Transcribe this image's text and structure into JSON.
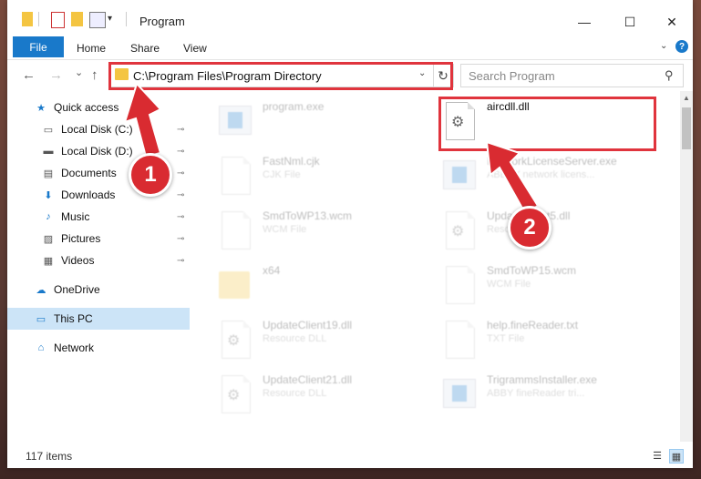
{
  "window": {
    "title": "Program",
    "minimize": "—",
    "maximize": "☐",
    "close": "✕"
  },
  "ribbon": {
    "file": "File",
    "home": "Home",
    "share": "Share",
    "view": "View",
    "help": "?",
    "collapse": "⌄"
  },
  "nav": {
    "back": "←",
    "forward": "→",
    "recent": "⌄",
    "up": "↑",
    "address": "C:\\Program Files\\Program Directory",
    "address_dropdown": "⌄",
    "refresh": "↻",
    "search_placeholder": "Search Program",
    "search_icon": "⚲"
  },
  "sidebar": {
    "items": [
      {
        "label": "Quick access",
        "icon": "star-icon",
        "glyph": "★",
        "pinned": false,
        "selected": false
      },
      {
        "label": "Local Disk (C:)",
        "icon": "drive-icon",
        "glyph": "▭",
        "pinned": true,
        "selected": false
      },
      {
        "label": "Local Disk (D:)",
        "icon": "drive-icon",
        "glyph": "▬",
        "pinned": true,
        "selected": false
      },
      {
        "label": "Documents",
        "icon": "documents-icon",
        "glyph": "▤",
        "pinned": true,
        "selected": false
      },
      {
        "label": "Downloads",
        "icon": "downloads-icon",
        "glyph": "⬇",
        "pinned": true,
        "selected": false
      },
      {
        "label": "Music",
        "icon": "music-icon",
        "glyph": "♪",
        "pinned": true,
        "selected": false
      },
      {
        "label": "Pictures",
        "icon": "pictures-icon",
        "glyph": "▨",
        "pinned": true,
        "selected": false
      },
      {
        "label": "Videos",
        "icon": "videos-icon",
        "glyph": "▦",
        "pinned": true,
        "selected": false
      },
      {
        "label": "OneDrive",
        "icon": "onedrive-icon",
        "glyph": "☁",
        "pinned": false,
        "selected": false
      },
      {
        "label": "This PC",
        "icon": "pc-icon",
        "glyph": "▭",
        "pinned": false,
        "selected": true
      },
      {
        "label": "Network",
        "icon": "network-icon",
        "glyph": "⌂",
        "pinned": false,
        "selected": false
      }
    ],
    "pin_glyph": "📌"
  },
  "files": [
    {
      "name": "program.exe",
      "type": "",
      "kind": "exe-icon",
      "faded": true
    },
    {
      "name": "aircdll.dll",
      "type": "",
      "kind": "dll-icon",
      "faded": false
    },
    {
      "name": "FastNml.cjk",
      "type": "CJK File",
      "kind": "document-icon",
      "faded": true
    },
    {
      "name": "NetworkLicenseServer.exe",
      "type": "ABBYY network licens...",
      "kind": "exe-icon",
      "faded": true
    },
    {
      "name": "SmdToWP13.wcm",
      "type": "WCM File",
      "kind": "document-icon",
      "faded": true
    },
    {
      "name": "UpdateClient5.dll",
      "type": "Resource DLL",
      "kind": "dll-icon",
      "faded": true
    },
    {
      "name": "x64",
      "type": "",
      "kind": "folder-icon",
      "faded": true
    },
    {
      "name": "SmdToWP15.wcm",
      "type": "WCM File",
      "kind": "document-icon",
      "faded": true
    },
    {
      "name": "UpdateClient19.dll",
      "type": "Resource DLL",
      "kind": "dll-icon",
      "faded": true
    },
    {
      "name": "help.fineReader.txt",
      "type": "TXT File",
      "kind": "document-icon",
      "faded": true
    },
    {
      "name": "UpdateClient21.dll",
      "type": "Resource DLL",
      "kind": "dll-icon",
      "faded": true
    },
    {
      "name": "TrigrammsInstaller.exe",
      "type": "ABBY fineReader tri...",
      "kind": "exe-icon",
      "faded": true
    }
  ],
  "status": {
    "items": "117 items",
    "details_view": "☰",
    "icons_view": "▦"
  },
  "annotations": {
    "step1": "1",
    "step2": "2",
    "color": "#e0343d"
  }
}
